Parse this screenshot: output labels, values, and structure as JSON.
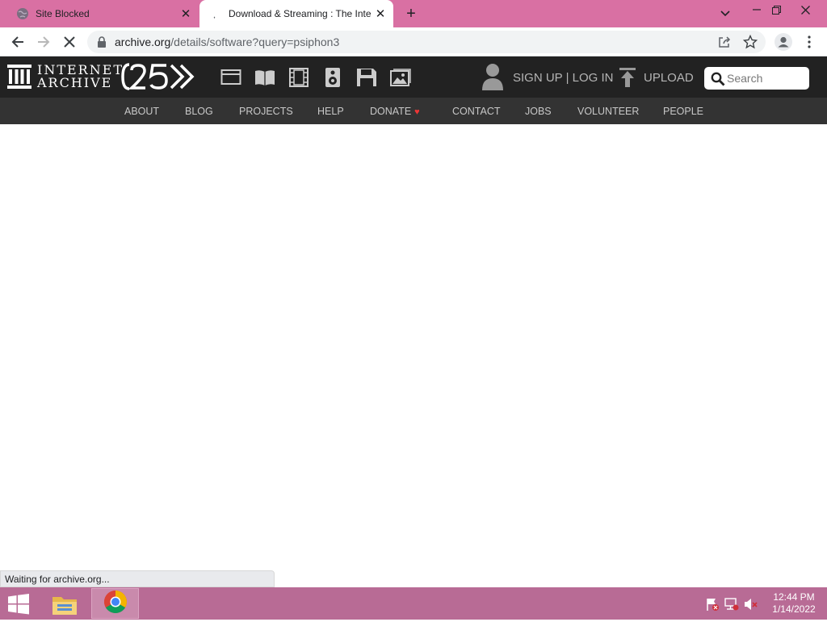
{
  "tabs": [
    {
      "title": "Site Blocked",
      "favicon": "globe-icon",
      "active": false
    },
    {
      "title": "Download & Streaming : The Inte",
      "favicon": "loading-spinner-icon",
      "active": true
    }
  ],
  "toolbar": {
    "url_domain": "archive.org",
    "url_path": "/details/software?query=psiphon3"
  },
  "ia": {
    "logo_line1": "INTERNET",
    "logo_line2": "ARCHIVE",
    "media_icons": [
      "web-icon",
      "texts-icon",
      "video-icon",
      "audio-icon",
      "software-icon",
      "images-icon"
    ],
    "signin": "SIGN UP | LOG IN",
    "upload": "UPLOAD",
    "search_placeholder": "Search",
    "nav": [
      "ABOUT",
      "BLOG",
      "PROJECTS",
      "HELP",
      "DONATE",
      "CONTACT",
      "JOBS",
      "VOLUNTEER",
      "PEOPLE"
    ],
    "heart_color": "#ef3636"
  },
  "status": "Waiting for archive.org...",
  "clock": {
    "time": "12:44 PM",
    "date": "1/14/2022"
  },
  "colors": {
    "tabstrip": "#d970a3",
    "taskbar": "#b86b95",
    "ia_header": "#222222",
    "ia_subnav": "#333333"
  }
}
